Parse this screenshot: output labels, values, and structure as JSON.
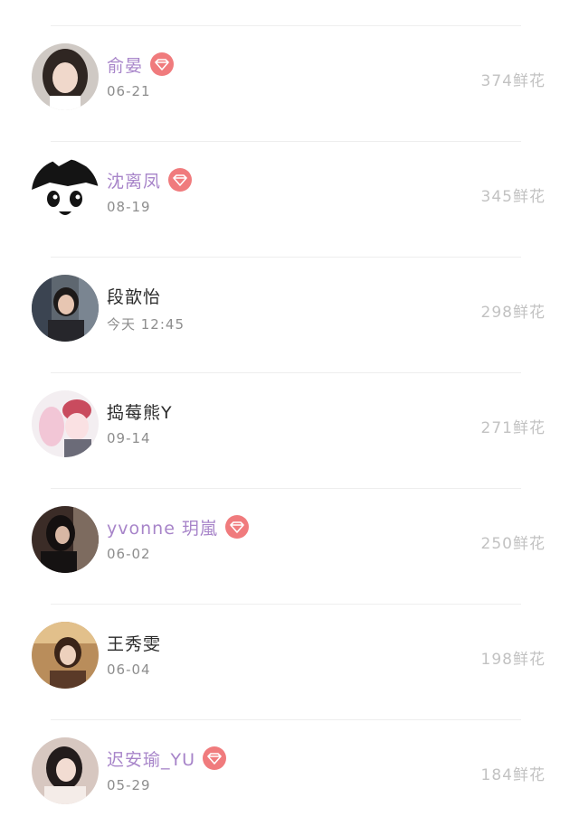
{
  "colors": {
    "vip_name": "#a784c9",
    "normal_name": "#2b2b2b",
    "date": "#8d8d8d",
    "flowers": "#c2c2c2",
    "badge": "#f07b7d",
    "divider": "#eeeeee"
  },
  "users": [
    {
      "name": "俞晏",
      "date": "06-21",
      "flowers": "374鲜花",
      "vip": true,
      "avatar_icon": "avatar-photo-icon"
    },
    {
      "name": "沈离凤",
      "date": "08-19",
      "flowers": "345鲜花",
      "vip": true,
      "avatar_icon": "avatar-cartoon-icon"
    },
    {
      "name": "段歆怡",
      "date": "今天 12:45",
      "flowers": "298鲜花",
      "vip": false,
      "avatar_icon": "avatar-photo-icon"
    },
    {
      "name": "捣莓熊Y",
      "date": "09-14",
      "flowers": "271鲜花",
      "vip": false,
      "avatar_icon": "avatar-anime-icon"
    },
    {
      "name": "yvonne 玥嵐",
      "date": "06-02",
      "flowers": "250鲜花",
      "vip": true,
      "avatar_icon": "avatar-photo-icon"
    },
    {
      "name": "王秀雯",
      "date": "06-04",
      "flowers": "198鲜花",
      "vip": false,
      "avatar_icon": "avatar-photo-icon"
    },
    {
      "name": "迟安瑜_YU",
      "date": "05-29",
      "flowers": "184鲜花",
      "vip": true,
      "avatar_icon": "avatar-photo-icon"
    }
  ],
  "vip_badge_icon": "diamond-icon"
}
